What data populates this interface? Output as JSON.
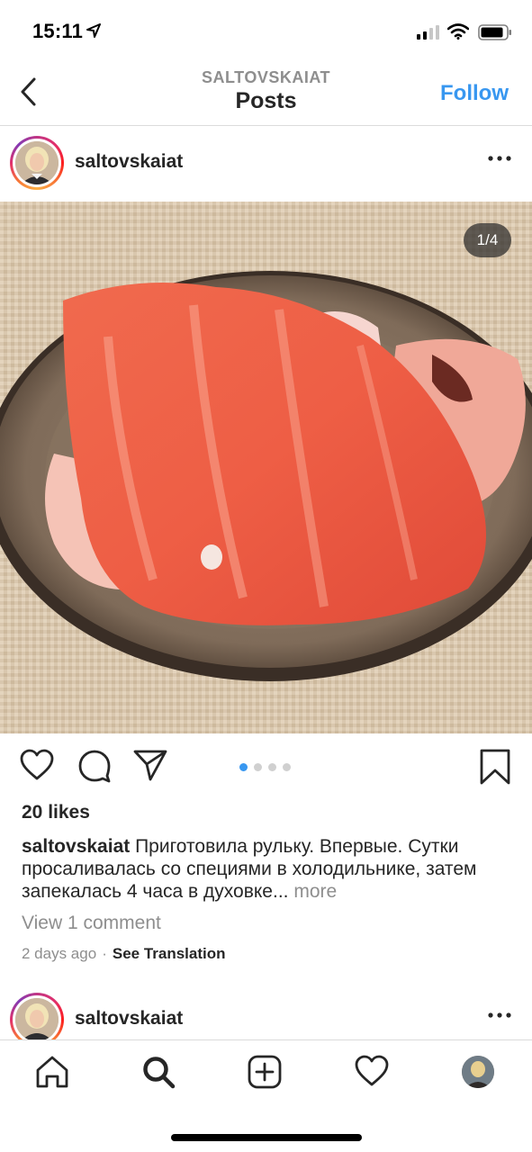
{
  "status_bar": {
    "time": "15:11"
  },
  "header": {
    "subtitle": "SALTOVSKAIAT",
    "title": "Posts",
    "follow_label": "Follow"
  },
  "post": {
    "username": "saltovskaiat",
    "photo_counter": "1/4",
    "carousel": {
      "total": 4,
      "active_index": 0
    },
    "likes": "20 likes",
    "caption_user": "saltovskaiat",
    "caption_text": " Приготовила рульку. Впервые. Сутки просаливалась со специями в холодильнике, затем запекалась 4 часа в духовке...",
    "caption_more": " more",
    "view_comments": "View 1 comment",
    "time_ago": "2 days ago",
    "separator": "·",
    "see_translation": "See Translation"
  },
  "next_post": {
    "username": "saltovskaiat"
  },
  "colors": {
    "accent": "#3897f0",
    "muted": "#8e8e8e",
    "text": "#262626"
  },
  "icons": [
    "back-icon",
    "more-icon",
    "heart-icon",
    "comment-icon",
    "share-icon",
    "bookmark-icon",
    "home-icon",
    "search-icon",
    "add-icon",
    "activity-icon"
  ]
}
